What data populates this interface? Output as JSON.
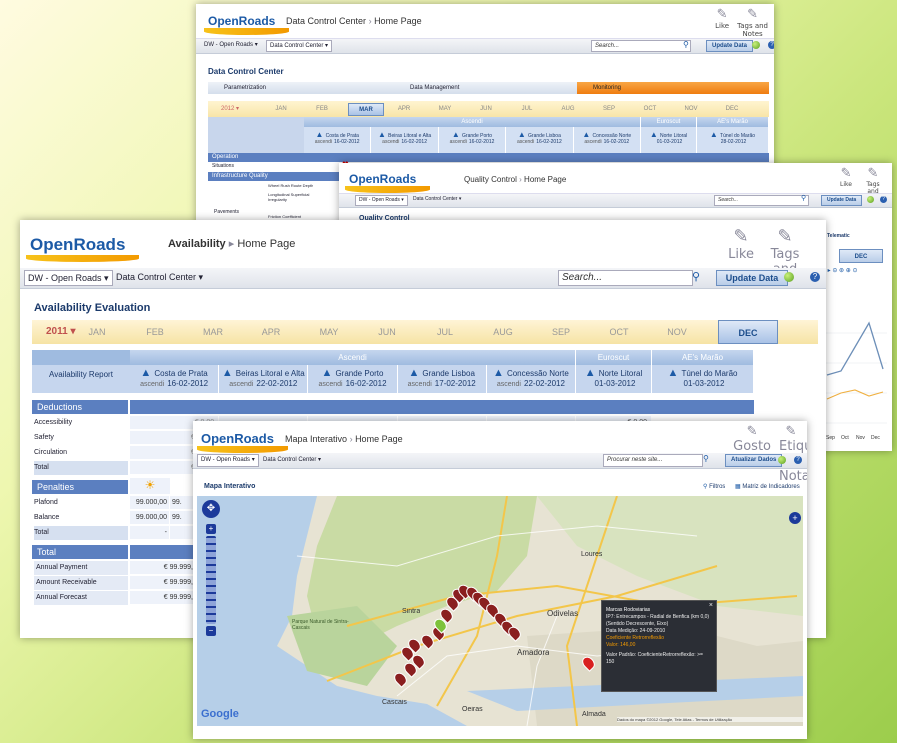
{
  "qc_top": {
    "title": "Data Control Center",
    "home": "Home Page",
    "nav_home": "DW - Open Roads",
    "nav_dcc": "Data Control Center",
    "search": "Search...",
    "update": "Update Data",
    "heading": "Data Control Center",
    "tabs": [
      "Parametrization",
      "Data Management",
      "Monitoring"
    ],
    "year": "2012",
    "months": [
      "JAN",
      "FEB",
      "MAR",
      "APR",
      "MAY",
      "JUN",
      "JUL",
      "AUG",
      "SEP",
      "OCT",
      "NOV",
      "DEC"
    ],
    "active_month": "MAR",
    "group_ascendi": "Ascendi",
    "group_euroscut": "Euroscut",
    "group_aes": "AE's Marão",
    "concessions": [
      {
        "name": "Costa de Prata",
        "sub": "ascendi",
        "date": "16-02-2012"
      },
      {
        "name": "Beiras Litoral e Alta",
        "sub": "ascendi",
        "date": "16-02-2012"
      },
      {
        "name": "Grande Porto",
        "sub": "ascendi",
        "date": "16-02-2012"
      },
      {
        "name": "Grande Lisboa",
        "sub": "ascendi",
        "date": "16-02-2012"
      },
      {
        "name": "Concessão Norte",
        "sub": "ascendi",
        "date": "16-02-2012"
      },
      {
        "name": "Norte Litoral",
        "sub": "",
        "date": "01-03-2012"
      },
      {
        "name": "Túnel do Marão",
        "sub": "",
        "date": "28-02-2012"
      }
    ],
    "operation": "Operation",
    "situations": "Situations",
    "infra": "Infrastructure Quality",
    "pavements": "Pavements",
    "rows": [
      "Wheel Rush Route Depth",
      "Longitudinal Superficial Irregularity",
      "Friction Coefficient"
    ]
  },
  "qc_mid": {
    "title": "Quality Control",
    "home": "Home Page",
    "nav_home": "DW - Open Roads",
    "nav_dcc": "Data Control Center",
    "search": "Search...",
    "update": "Update Data",
    "heading": "Quality Control",
    "like": "Like",
    "tags": "Tags and Notes",
    "telematic": "Telematic",
    "dec": "DEC",
    "chart_months": [
      "Sep",
      "Oct",
      "Nov",
      "Dec"
    ]
  },
  "avail": {
    "title": "Availability",
    "home": "Home Page",
    "nav_home": "DW - Open Roads",
    "nav_dcc": "Data Control Center",
    "search": "Search...",
    "update": "Update Data",
    "like": "Like",
    "tags": "Tags and Notes",
    "heading": "Availability Evaluation",
    "year": "2011",
    "months": [
      "JAN",
      "FEB",
      "MAR",
      "APR",
      "MAY",
      "JUN",
      "JUL",
      "AUG",
      "SEP",
      "OCT",
      "NOV",
      "DEC"
    ],
    "active_month": "DEC",
    "group_ascendi": "Ascendi",
    "group_euroscut": "Euroscut",
    "group_aes": "AE's Marão",
    "report_label": "Availability Report",
    "concessions": [
      {
        "name": "Costa de Prata",
        "sub": "ascendi",
        "date": "16-02-2012"
      },
      {
        "name": "Beiras Litoral e Alta",
        "sub": "ascendi",
        "date": "22-02-2012"
      },
      {
        "name": "Grande Porto",
        "sub": "ascendi",
        "date": "16-02-2012"
      },
      {
        "name": "Grande Lisboa",
        "sub": "ascendi",
        "date": "17-02-2012"
      },
      {
        "name": "Concessão Norte",
        "sub": "ascendi",
        "date": "22-02-2012"
      },
      {
        "name": "Norte Litoral",
        "sub": "",
        "date": "01-03-2012"
      },
      {
        "name": "Túnel do Marão",
        "sub": "",
        "date": "01-03-2012"
      }
    ],
    "deductions": "Deductions",
    "deduction_rows": [
      "Accessibility",
      "Safety",
      "Circulation",
      "Total"
    ],
    "deduction_vals": [
      "€ 0,00",
      "€ 999,9",
      "€ 999,9",
      "€ 999,9"
    ],
    "euroscut_val": "€ 0,00",
    "penalties": "Penalties",
    "penalty_rows": [
      "Plafond",
      "Balance",
      "Total"
    ],
    "penalty_vals": [
      "99.000,00",
      "99.000,00",
      "-"
    ],
    "penalty_vals2": [
      "99.",
      "99.",
      ""
    ],
    "total": "Total",
    "total_rows": [
      "Annual Payment",
      "Amount Receivable",
      "Annual Forecast"
    ],
    "total_vals": [
      "€ 99.999,",
      "€ 99.999,",
      "€ 99.999,"
    ]
  },
  "mapa": {
    "title": "Mapa Interativo",
    "home": "Home Page",
    "nav_home": "DW - Open Roads",
    "nav_dcc": "Data Control Center",
    "search": "Procurar neste site...",
    "update": "Atualizar Dados",
    "gosto": "Gosto",
    "etiquetas": "Etiquetas e Notas",
    "heading": "Mapa Interativo",
    "filtros": "Filtros",
    "matriz": "Matriz de Indicadores",
    "places": [
      "Loures",
      "Odivelas",
      "Amadora",
      "Sintra",
      "Cascais",
      "Oeiras",
      "Almada",
      "Parque Natural de Sintra-Cascais"
    ],
    "popup": {
      "title": "Marcas Rodoviarias",
      "line1": "IP7: Entrecampos - Radial de Benfica (km 0,0) (Sentido Decrescente, Eixo)",
      "line2": "Data Medição: 24-09-2010",
      "line3": "Coeficiente Retrorreflexão",
      "line4": "Valor: 146,00",
      "line5": "Valor Padrão: CoeficienteRetrorreflexão: >= 150"
    },
    "google": "Google",
    "copyright": "Dados do mapa ©2012 Google, Tele Atlas - Termos de Utilização"
  }
}
